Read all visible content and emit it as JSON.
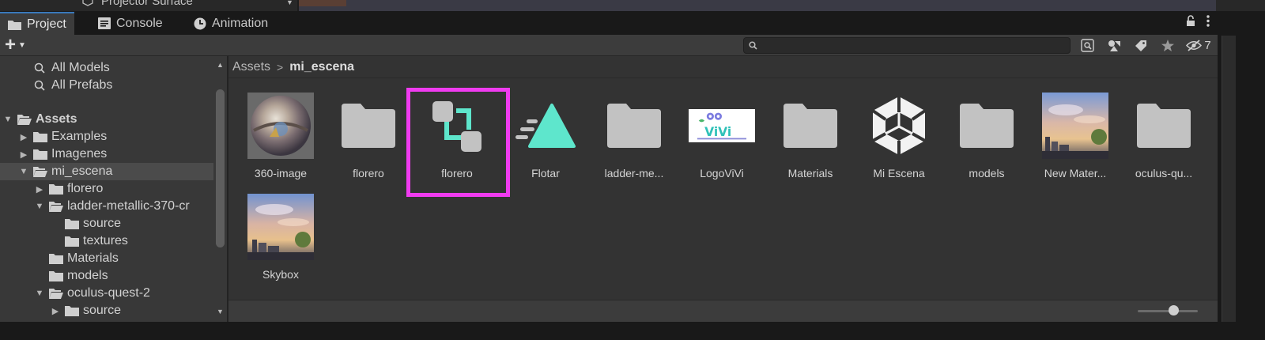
{
  "hierarchy_partial": {
    "text": "Projector Surface"
  },
  "tabs": [
    {
      "label": "Project",
      "icon": "folder-icon",
      "active": true
    },
    {
      "label": "Console",
      "icon": "console-icon",
      "active": false
    },
    {
      "label": "Animation",
      "icon": "clock-icon",
      "active": false
    }
  ],
  "toolbar": {
    "add_label": "+",
    "search": {
      "value": "",
      "placeholder": ""
    },
    "hidden_count": "7"
  },
  "tree": {
    "items": [
      {
        "label": "All Models",
        "icon": "search-icon",
        "indent": 2,
        "arrow": ""
      },
      {
        "label": "All Prefabs",
        "icon": "search-icon",
        "indent": 2,
        "arrow": ""
      },
      {
        "label": "Assets",
        "icon": "open-folder-icon",
        "indent": 0,
        "arrow": "down",
        "bold": true
      },
      {
        "label": "Examples",
        "icon": "folder-icon",
        "indent": 1,
        "arrow": "right"
      },
      {
        "label": "Imagenes",
        "icon": "folder-icon",
        "indent": 1,
        "arrow": "right"
      },
      {
        "label": "mi_escena",
        "icon": "open-folder-icon",
        "indent": 1,
        "arrow": "down",
        "selected": true
      },
      {
        "label": "florero",
        "icon": "folder-icon",
        "indent": 2,
        "arrow": "right"
      },
      {
        "label": "ladder-metallic-370-cr",
        "icon": "open-folder-icon",
        "indent": 2,
        "arrow": "down"
      },
      {
        "label": "source",
        "icon": "folder-icon",
        "indent": 3,
        "arrow": ""
      },
      {
        "label": "textures",
        "icon": "folder-icon",
        "indent": 3,
        "arrow": ""
      },
      {
        "label": "Materials",
        "icon": "folder-icon",
        "indent": 2,
        "arrow": ""
      },
      {
        "label": "models",
        "icon": "folder-icon",
        "indent": 2,
        "arrow": ""
      },
      {
        "label": "oculus-quest-2",
        "icon": "open-folder-icon",
        "indent": 2,
        "arrow": "down"
      },
      {
        "label": "source",
        "icon": "folder-icon",
        "indent": 3,
        "arrow": "right"
      }
    ]
  },
  "breadcrumb": {
    "root": "Assets",
    "separator": ">",
    "current": "mi_escena"
  },
  "assets": [
    {
      "label": "360-image",
      "kind": "sphere-image"
    },
    {
      "label": "florero",
      "kind": "folder"
    },
    {
      "label": "florero",
      "kind": "prefab",
      "highlighted": true
    },
    {
      "label": "Flotar",
      "kind": "animation"
    },
    {
      "label": "ladder-me...",
      "kind": "folder"
    },
    {
      "label": "LogoViVi",
      "kind": "logo"
    },
    {
      "label": "Materials",
      "kind": "folder"
    },
    {
      "label": "Mi Escena",
      "kind": "unity-scene"
    },
    {
      "label": "models",
      "kind": "folder"
    },
    {
      "label": "New Mater...",
      "kind": "sky-image"
    },
    {
      "label": "oculus-qu...",
      "kind": "folder"
    },
    {
      "label": "Skybox",
      "kind": "sky-image"
    }
  ],
  "logo_text": "ViVi",
  "colors": {
    "highlight": "#f03bf0",
    "prefab_teal": "#5ee6cc",
    "folder_gray": "#c2c2c2",
    "tab_accent": "#3a79bb"
  }
}
